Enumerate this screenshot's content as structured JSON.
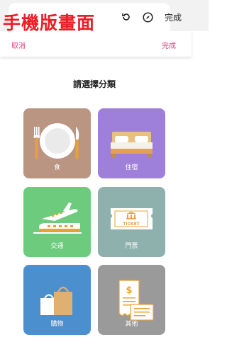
{
  "overlay": {
    "caption": "手機版畫面"
  },
  "toolbar": {
    "done_label": "完成"
  },
  "header": {
    "cancel_label": "取消",
    "done_label": "完成"
  },
  "main": {
    "title": "請選擇分類",
    "categories": [
      {
        "label": "食",
        "color": "#b99582",
        "icon": "plate-cutlery-icon"
      },
      {
        "label": "住宿",
        "color": "#9e7fd9",
        "icon": "bed-icon"
      },
      {
        "label": "交通",
        "color": "#6ccb7d",
        "icon": "plane-train-icon"
      },
      {
        "label": "門票",
        "color": "#8fb1ad",
        "icon": "ticket-icon"
      },
      {
        "label": "購物",
        "color": "#4c8fcf",
        "icon": "shopping-bag-icon"
      },
      {
        "label": "其他",
        "color": "#9a9a9a",
        "icon": "receipt-icon"
      }
    ]
  }
}
